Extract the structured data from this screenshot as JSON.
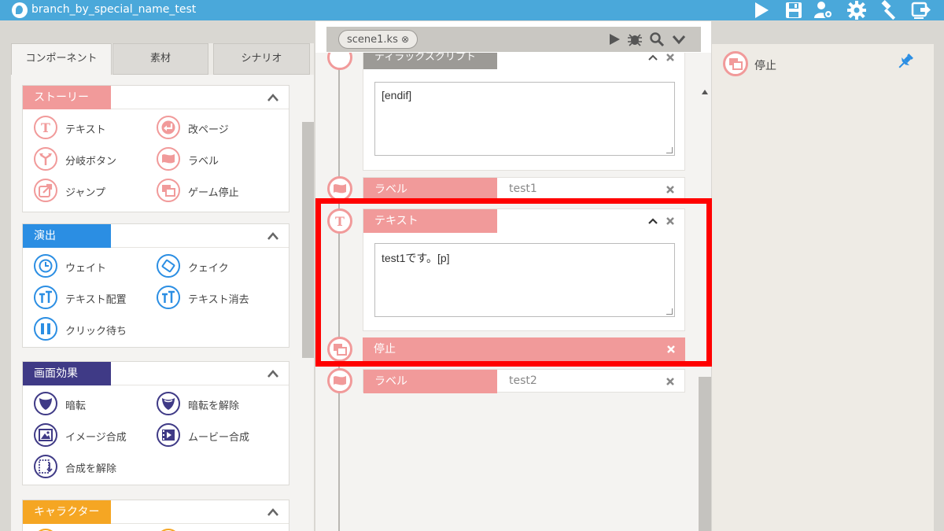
{
  "app": {
    "title": "branch_by_special_name_test"
  },
  "left_panel": {
    "tabs": [
      {
        "label": "コンポーネント",
        "active": true
      },
      {
        "label": "素材",
        "active": false
      },
      {
        "label": "シナリオ",
        "active": false
      }
    ],
    "sections": [
      {
        "title": "ストーリー",
        "color": "#f19a9a",
        "items": [
          {
            "label": "テキスト",
            "icon": "text-T-icon"
          },
          {
            "label": "改ページ",
            "icon": "return-arrow-icon"
          },
          {
            "label": "分岐ボタン",
            "icon": "branch-icon"
          },
          {
            "label": "ラベル",
            "icon": "flag-icon"
          },
          {
            "label": "ジャンプ",
            "icon": "jump-icon"
          },
          {
            "label": "ゲーム停止",
            "icon": "stop-windows-icon"
          }
        ]
      },
      {
        "title": "演出",
        "color": "#2b8ee3",
        "items": [
          {
            "label": "ウェイト",
            "icon": "clock-icon"
          },
          {
            "label": "クェイク",
            "icon": "quake-icon"
          },
          {
            "label": "テキスト配置",
            "icon": "text-position-icon"
          },
          {
            "label": "テキスト消去",
            "icon": "text-erase-icon"
          },
          {
            "label": "クリック待ち",
            "icon": "pause-icon"
          }
        ]
      },
      {
        "title": "画面効果",
        "color": "#3f3a86",
        "items": [
          {
            "label": "暗転",
            "icon": "shield-dark-icon"
          },
          {
            "label": "暗転を解除",
            "icon": "shield-light-icon"
          },
          {
            "label": "イメージ合成",
            "icon": "image-icon"
          },
          {
            "label": "ムービー合成",
            "icon": "movie-icon"
          },
          {
            "label": "合成を解除",
            "icon": "clear-composite-icon"
          }
        ]
      },
      {
        "title": "キャラクター",
        "color": "#f5a623",
        "items": []
      }
    ]
  },
  "editor": {
    "scene_tab": "scene1.ks",
    "partial_block_title": "ティラックスクリプト",
    "blocks": [
      {
        "type": "script",
        "content": "[endif]"
      },
      {
        "type": "label",
        "title": "ラベル",
        "value": "test1"
      },
      {
        "type": "text",
        "title": "テキスト",
        "content": "test1です。[p]"
      },
      {
        "type": "stop",
        "title": "停止"
      },
      {
        "type": "label",
        "title": "ラベル",
        "value": "test2"
      }
    ]
  },
  "right_panel": {
    "item_label": "停止",
    "icon": "stop-windows-icon",
    "pin_icon": "pin-icon"
  },
  "colors": {
    "titlebar": "#4aa8da",
    "story": "#f19a9a",
    "effect": "#2b8ee3",
    "screen": "#3f3a86",
    "character": "#f5a623",
    "highlight": "#ff0000"
  }
}
